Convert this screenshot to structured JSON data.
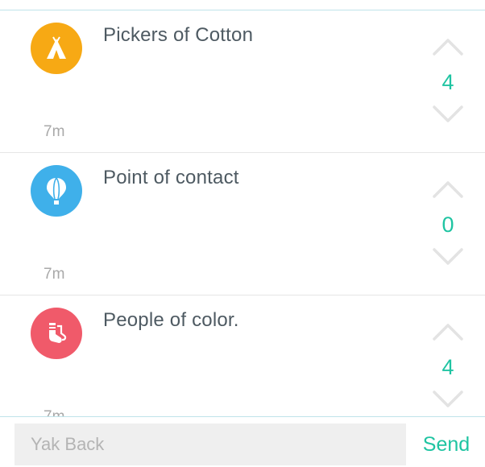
{
  "colors": {
    "accent": "#1fc4a2",
    "divider": "#e6e6e6",
    "rule": "#bfe3ea",
    "text": "#4e5a62",
    "muted": "#a9a9a9",
    "chevron": "#e3e3e3"
  },
  "feed": {
    "yaks": [
      {
        "text": "Pickers of Cotton",
        "time": "7m",
        "votes": "4",
        "icon": "teepee-icon",
        "icon_color": "#f7a914"
      },
      {
        "text": "Point of contact",
        "time": "7m",
        "votes": "0",
        "icon": "hot-air-balloon-icon",
        "icon_color": "#3fb0ea"
      },
      {
        "text": "People of color.",
        "time": "7m",
        "votes": "4",
        "icon": "socks-icon",
        "icon_color": "#f05a6a"
      }
    ]
  },
  "compose": {
    "placeholder": "Yak Back",
    "send_label": "Send"
  }
}
